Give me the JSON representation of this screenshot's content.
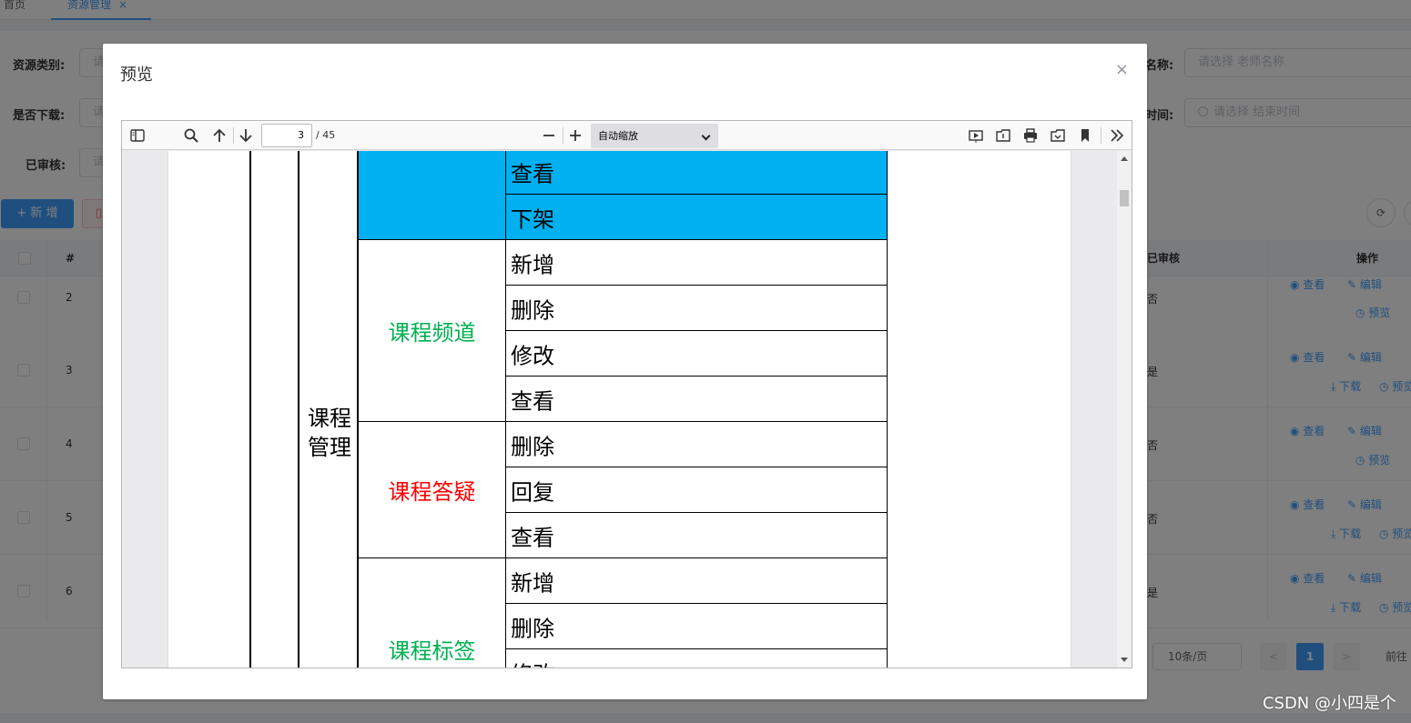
{
  "tabs": {
    "home": "首页",
    "active": "资源管理",
    "close": "×"
  },
  "filters": {
    "category_label": "资源类别:",
    "category_placeholder": "请",
    "download_label": "是否下载:",
    "download_placeholder": "请",
    "audited_label": "已审核:",
    "audited_placeholder": "请",
    "teacher_label": "名称:",
    "teacher_placeholder": "请选择 老师名称",
    "endtime_label": "时间:",
    "endtime_placeholder": "请选择 结束时间"
  },
  "toolbar": {
    "add_label": "+ 新 增",
    "delete_icon": "trash-icon"
  },
  "table": {
    "headers": {
      "index": "#",
      "audited": "已审核",
      "ops": "操作"
    },
    "rows": [
      {
        "num": "2",
        "audited": "否",
        "ops1": [
          "查看",
          "编辑"
        ],
        "ops2": [
          "预览"
        ]
      },
      {
        "num": "3",
        "audited": "是",
        "ops1": [
          "查看",
          "编辑"
        ],
        "ops2": [
          "下载",
          "预览"
        ]
      },
      {
        "num": "4",
        "audited": "否",
        "ops1": [
          "查看",
          "编辑"
        ],
        "ops2": [
          "预览"
        ]
      },
      {
        "num": "5",
        "audited": "否",
        "ops1": [
          "查看",
          "编辑"
        ],
        "ops2": [
          "下载",
          "预览"
        ]
      },
      {
        "num": "6",
        "audited": "是",
        "ops1": [
          "查看",
          "编辑"
        ],
        "ops2": [
          "下载",
          "预览"
        ]
      }
    ]
  },
  "pagination": {
    "page_size": "10条/页",
    "prev": "<",
    "current": "1",
    "next": ">",
    "goto": "前往"
  },
  "dialog": {
    "title": "预览",
    "close": "×",
    "viewer": {
      "page_number": "3",
      "page_total": "/ 45",
      "zoom": "自动缩放",
      "colors": {
        "highlight": "#00b0f0",
        "green": "#00b050",
        "red": "#ff0000"
      }
    },
    "pdf": {
      "module": "课程管理",
      "blue_rows": [
        "查看",
        "下架"
      ],
      "groups": [
        {
          "name": "课程频道",
          "color": "green",
          "actions": [
            "新增",
            "删除",
            "修改",
            "查看"
          ]
        },
        {
          "name": "课程答疑",
          "color": "red",
          "actions": [
            "删除",
            "回复",
            "查看"
          ]
        },
        {
          "name": "课程标签",
          "color": "green",
          "actions": [
            "新增",
            "删除",
            "修改"
          ]
        }
      ]
    }
  },
  "watermark": "CSDN @小四是个"
}
